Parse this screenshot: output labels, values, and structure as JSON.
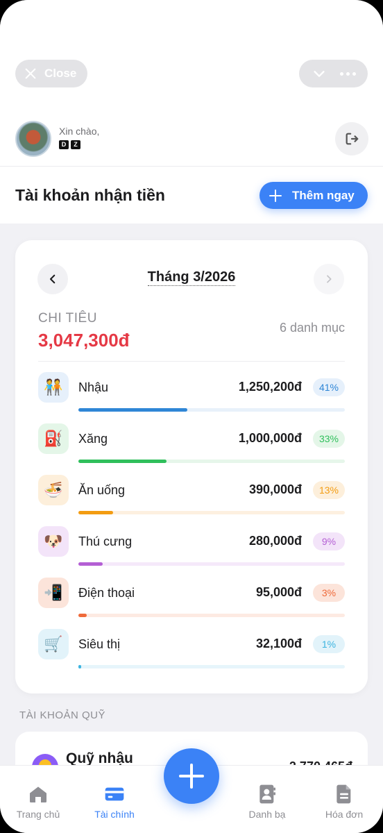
{
  "header": {
    "close_label": "Close"
  },
  "profile": {
    "greeting": "Xin chào,",
    "name_letters": [
      "D",
      "Z"
    ]
  },
  "section": {
    "title": "Tài khoản nhận tiền",
    "add_label": "Thêm ngay"
  },
  "summary": {
    "month": "Tháng 3/2026",
    "spend_label": "CHI TIÊU",
    "total": "3,047,300đ",
    "category_count": "6 danh mục"
  },
  "categories": [
    {
      "name": "Nhậu",
      "amount": "1,250,200đ",
      "percent_label": "41%",
      "fraction": 0.41,
      "icon": "🧑‍🤝‍🧑",
      "color": "#2f86d6",
      "track": "#e8f1fa",
      "badge_bg": "#e6f0fb",
      "icon_bg": "#e6f0fb"
    },
    {
      "name": "Xăng",
      "amount": "1,000,000đ",
      "percent_label": "33%",
      "fraction": 0.33,
      "icon": "⛽",
      "color": "#2fbf5b",
      "track": "#e6f6ea",
      "badge_bg": "#e4f6e8",
      "icon_bg": "#e4f6e8"
    },
    {
      "name": "Ăn uống",
      "amount": "390,000đ",
      "percent_label": "13%",
      "fraction": 0.13,
      "icon": "🍜",
      "color": "#f39c12",
      "track": "#fdf0e0",
      "badge_bg": "#fdefdb",
      "icon_bg": "#fdefdb"
    },
    {
      "name": "Thú cưng",
      "amount": "280,000đ",
      "percent_label": "9%",
      "fraction": 0.09,
      "icon": "🐶",
      "color": "#b45fd4",
      "track": "#f5e9fa",
      "badge_bg": "#f3e4f9",
      "icon_bg": "#f3e4f9"
    },
    {
      "name": "Điện thoại",
      "amount": "95,000đ",
      "percent_label": "3%",
      "fraction": 0.03,
      "icon": "📲",
      "color": "#ef6a3a",
      "track": "#fdeae2",
      "badge_bg": "#fce4da",
      "icon_bg": "#fce4da"
    },
    {
      "name": "Siêu thị",
      "amount": "32,100đ",
      "percent_label": "1%",
      "fraction": 0.01,
      "icon": "🛒",
      "color": "#3cb4e0",
      "track": "#e6f5fb",
      "badge_bg": "#e2f3fa",
      "icon_bg": "#e2f3fa"
    }
  ],
  "fund": {
    "section_label": "TÀI KHOẢN QUỸ",
    "name": "Quỹ nhậu",
    "amount": "2,770,465đ"
  },
  "tabs": [
    {
      "label": "Trang chủ",
      "icon": "home-icon"
    },
    {
      "label": "Tài chính",
      "icon": "wallet-icon",
      "active": true
    },
    {
      "label": "Danh bạ",
      "icon": "contacts-icon"
    },
    {
      "label": "Hóa đơn",
      "icon": "invoice-icon"
    }
  ],
  "colors": {
    "accent": "#3b82f6",
    "expense": "#e53945"
  }
}
